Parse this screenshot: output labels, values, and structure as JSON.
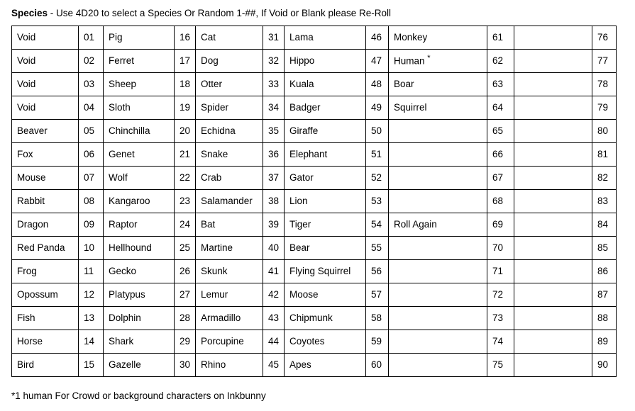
{
  "heading": {
    "bold_part": "Species",
    "rest": " - Use 4D20 to select a Species Or Random 1-##, If Void or Blank please Re-Roll"
  },
  "footnote": {
    "text": "*1 human For Crowd or background characters on Inkbunny"
  },
  "table": {
    "rows": [
      {
        "n1": "Void",
        "i1": "01",
        "n2": "Pig",
        "i2": "16",
        "n3": "Cat",
        "i3": "31",
        "n4": "Lama",
        "i4": "46",
        "n5": "Monkey",
        "i5": "61",
        "n6": "",
        "i6": "76"
      },
      {
        "n1": "Void",
        "i1": "02",
        "n2": "Ferret",
        "i2": "17",
        "n3": "Dog",
        "i3": "32",
        "n4": "Hippo",
        "i4": "47",
        "n5": "Human *",
        "i5": "62",
        "n6": "",
        "i6": "77"
      },
      {
        "n1": "Void",
        "i1": "03",
        "n2": "Sheep",
        "i2": "18",
        "n3": "Otter",
        "i3": "33",
        "n4": "Kuala",
        "i4": "48",
        "n5": "Boar",
        "i5": "63",
        "n6": "",
        "i6": "78"
      },
      {
        "n1": "Void",
        "i1": "04",
        "n2": "Sloth",
        "i2": "19",
        "n3": "Spider",
        "i3": "34",
        "n4": "Badger",
        "i4": "49",
        "n5": "Squirrel",
        "i5": "64",
        "n6": "",
        "i6": "79"
      },
      {
        "n1": "Beaver",
        "i1": "05",
        "n2": "Chinchilla",
        "i2": "20",
        "n3": "Echidna",
        "i3": "35",
        "n4": "Giraffe",
        "i4": "50",
        "n5": "",
        "i5": "65",
        "n6": "",
        "i6": "80"
      },
      {
        "n1": "Fox",
        "i1": "06",
        "n2": "Genet",
        "i2": "21",
        "n3": "Snake",
        "i3": "36",
        "n4": "Elephant",
        "i4": "51",
        "n5": "",
        "i5": "66",
        "n6": "",
        "i6": "81"
      },
      {
        "n1": "Mouse",
        "i1": "07",
        "n2": "Wolf",
        "i2": "22",
        "n3": "Crab",
        "i3": "37",
        "n4": "Gator",
        "i4": "52",
        "n5": "",
        "i5": "67",
        "n6": "",
        "i6": "82"
      },
      {
        "n1": "Rabbit",
        "i1": "08",
        "n2": "Kangaroo",
        "i2": "23",
        "n3": "Salamander",
        "i3": "38",
        "n4": "Lion",
        "i4": "53",
        "n5": "",
        "i5": "68",
        "n6": "",
        "i6": "83"
      },
      {
        "n1": "Dragon",
        "i1": "09",
        "n2": "Raptor",
        "i2": "24",
        "n3": "Bat",
        "i3": "39",
        "n4": "Tiger",
        "i4": "54",
        "n5": "Roll Again",
        "i5": "69",
        "n6": "",
        "i6": "84"
      },
      {
        "n1": "Red Panda",
        "i1": "10",
        "n2": "Hellhound",
        "i2": "25",
        "n3": "Martine",
        "i3": "40",
        "n4": "Bear",
        "i4": "55",
        "n5": "",
        "i5": "70",
        "n6": "",
        "i6": "85"
      },
      {
        "n1": "Frog",
        "i1": "11",
        "n2": "Gecko",
        "i2": "26",
        "n3": "Skunk",
        "i3": "41",
        "n4": "Flying Squirrel",
        "i4": "56",
        "n5": "",
        "i5": "71",
        "n6": "",
        "i6": "86"
      },
      {
        "n1": "Opossum",
        "i1": "12",
        "n2": "Platypus",
        "i2": "27",
        "n3": "Lemur",
        "i3": "42",
        "n4": "Moose",
        "i4": "57",
        "n5": "",
        "i5": "72",
        "n6": "",
        "i6": "87"
      },
      {
        "n1": "Fish",
        "i1": "13",
        "n2": "Dolphin",
        "i2": "28",
        "n3": "Armadillo",
        "i3": "43",
        "n4": "Chipmunk",
        "i4": "58",
        "n5": "",
        "i5": "73",
        "n6": "",
        "i6": "88"
      },
      {
        "n1": "Horse",
        "i1": "14",
        "n2": "Shark",
        "i2": "29",
        "n3": "Porcupine",
        "i3": "44",
        "n4": "Coyotes",
        "i4": "59",
        "n5": "",
        "i5": "74",
        "n6": "",
        "i6": "89"
      },
      {
        "n1": "Bird",
        "i1": "15",
        "n2": "Gazelle",
        "i2": "30",
        "n3": "Rhino",
        "i3": "45",
        "n4": "Apes",
        "i4": "60",
        "n5": "",
        "i5": "75",
        "n6": "",
        "i6": "90"
      }
    ]
  },
  "colors": {
    "text": "#000000",
    "border": "#000000",
    "background": "#ffffff"
  }
}
